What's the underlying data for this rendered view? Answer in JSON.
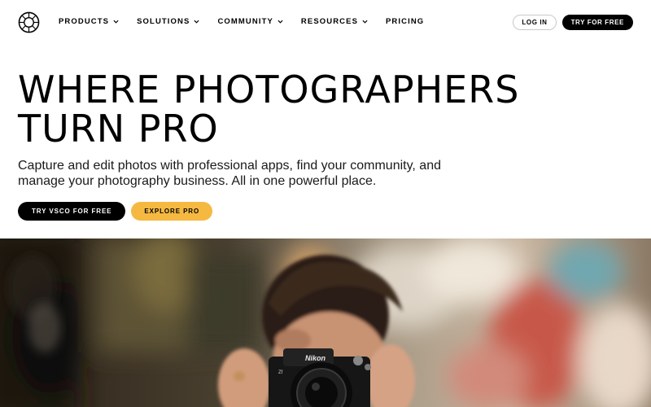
{
  "nav": {
    "logo_icon": "vsco-logo-icon",
    "items": [
      {
        "label": "PRODUCTS",
        "has_dropdown": true
      },
      {
        "label": "SOLUTIONS",
        "has_dropdown": true
      },
      {
        "label": "COMMUNITY",
        "has_dropdown": true
      },
      {
        "label": "RESOURCES",
        "has_dropdown": true
      },
      {
        "label": "PRICING",
        "has_dropdown": false
      }
    ],
    "login_label": "LOG IN",
    "try_label": "TRY FOR FREE"
  },
  "hero": {
    "title_lines": [
      "WHERE PHOTOGRAPHERS",
      "TURN PRO"
    ],
    "subtitle_lines": [
      "Capture and edit photos with professional apps, find your community, and",
      "manage your photography business. All in one powerful place."
    ],
    "primary_cta": "TRY VSCO FOR FREE",
    "secondary_cta": "EXPLORE PRO"
  },
  "colors": {
    "accent": "#f5b942",
    "primary": "#000000",
    "background": "#ffffff"
  },
  "photo": {
    "subject": "photographer-with-camera-image",
    "camera_brand_text": "Nikon"
  }
}
